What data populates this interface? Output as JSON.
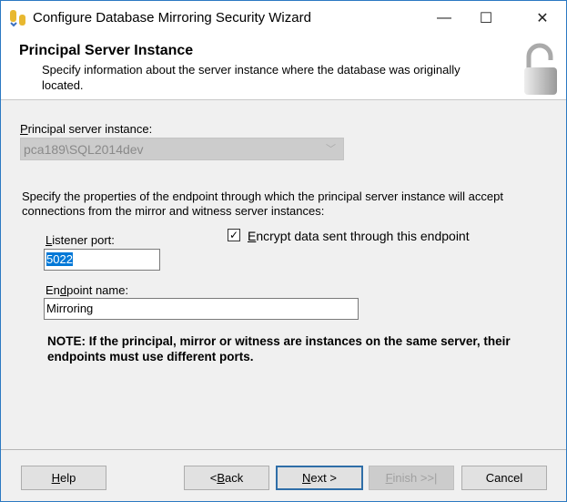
{
  "window": {
    "title": "Configure Database Mirroring Security Wizard",
    "minimize": "—",
    "maximize": "☐",
    "close": "✕"
  },
  "header": {
    "title": "Principal Server Instance",
    "description": "Specify information about the server instance where the database was originally located."
  },
  "principal": {
    "label_key": "P",
    "label_rest": "rincipal server instance:",
    "value": "pca189\\SQL2014dev",
    "chevron": "﹀"
  },
  "endpoint_desc": "Specify the properties of the endpoint through which the principal server instance will accept connections from the mirror and witness server instances:",
  "listener": {
    "label_key": "L",
    "label_rest": "istener port:",
    "value": "5022"
  },
  "encrypt": {
    "checked": true,
    "check": "✓",
    "label_key": "E",
    "label_rest": "ncrypt data sent through this endpoint"
  },
  "endpoint_name": {
    "label_pre": "En",
    "label_key": "d",
    "label_rest": "point name:",
    "value": "Mirroring"
  },
  "note": "NOTE: If the principal, mirror or witness are instances on the same server, their endpoints must use different ports.",
  "buttons": {
    "help": {
      "pre": "",
      "key": "H",
      "rest": "elp"
    },
    "back": {
      "pre": "< ",
      "key": "B",
      "rest": "ack"
    },
    "next": {
      "pre": "",
      "key": "N",
      "rest": "ext >"
    },
    "finish": {
      "pre": "",
      "key": "F",
      "rest": "inish >>|",
      "disabled": true
    },
    "cancel": {
      "pre": "Cancel",
      "key": "",
      "rest": ""
    }
  }
}
